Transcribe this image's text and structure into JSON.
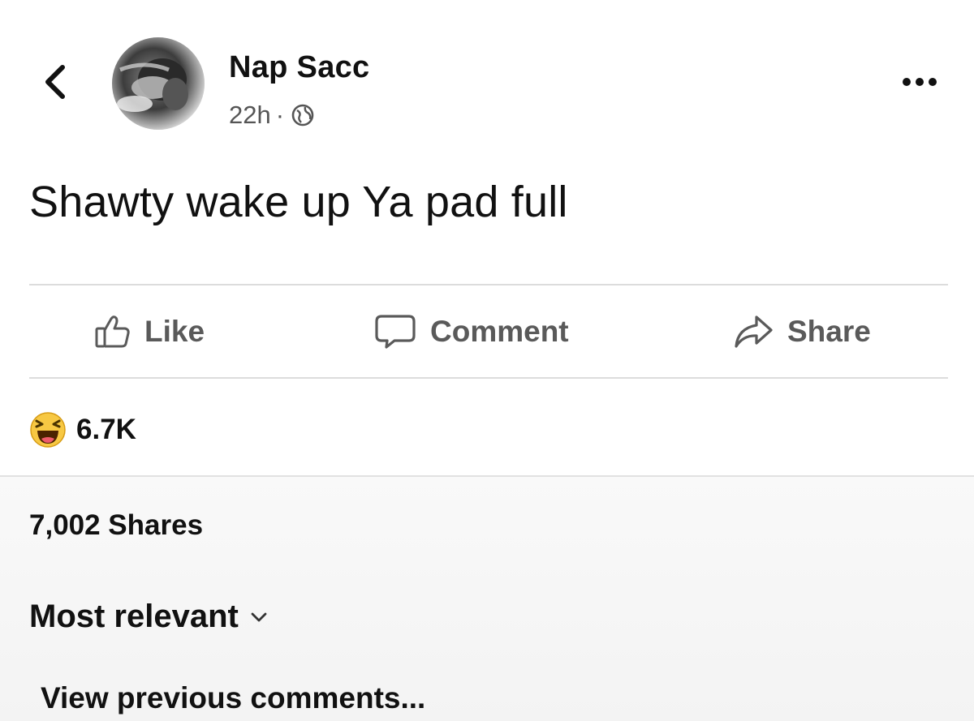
{
  "post": {
    "author": "Nap Sacc",
    "time": "22h",
    "separator": "·",
    "text": "Shawty wake up Ya pad full"
  },
  "actions": {
    "like": "Like",
    "comment": "Comment",
    "share": "Share"
  },
  "reactions": {
    "emoji": "haha-react-icon",
    "count": "6.7K"
  },
  "shares": {
    "text": "7,002 Shares"
  },
  "comments": {
    "sort_label": "Most relevant",
    "view_previous": "View previous comments..."
  },
  "icons": {
    "back": "chevron-left-icon",
    "privacy": "globe-icon",
    "more": "more-dots-icon",
    "like": "thumbs-up-icon",
    "comment": "speech-bubble-icon",
    "share": "share-arrow-icon",
    "sort": "chevron-down-icon"
  },
  "colors": {
    "text": "#111111",
    "muted": "#5a5a5a",
    "divider": "#dcdcdc",
    "reaction_yellow": "#f7c843"
  }
}
